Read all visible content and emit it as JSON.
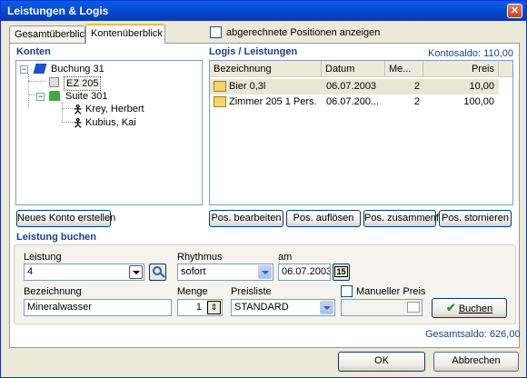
{
  "window": {
    "title": "Leistungen & Logis",
    "close_label": "✕"
  },
  "tabs": [
    {
      "label": "Gesamtüberblick"
    },
    {
      "label": "Kontenüberblick"
    }
  ],
  "show_settled": {
    "label": "abgerechnete Positionen anzeigen",
    "checked": false
  },
  "konten": {
    "title": "Konten",
    "tree": [
      {
        "label": "Buchung 31",
        "icon": "booking-icon"
      },
      {
        "label": "EZ 205",
        "icon": "room-icon"
      },
      {
        "label": "Suite 301",
        "icon": "suite-icon"
      },
      {
        "label": "Krey, Herbert",
        "icon": "person-icon"
      },
      {
        "label": "Kubius, Kai",
        "icon": "person-icon"
      }
    ],
    "new_account_button": "Neues Konto erstellen"
  },
  "logis": {
    "title": "Logis / Leistungen",
    "saldo": "Kontosaldo: 110,00",
    "columns": [
      "Bezeichnung",
      "Datum",
      "Me...",
      "Preis"
    ],
    "rows": [
      {
        "bezeichnung": "Bier 0,3l",
        "datum": "06.07.2003",
        "menge": "2",
        "preis": "10,00"
      },
      {
        "bezeichnung": "Zimmer 205  1 Pers.",
        "datum": "06.07.200...",
        "menge": "2",
        "preis": "100,00"
      }
    ],
    "buttons": [
      "Pos. bearbeiten",
      "Pos. auflösen",
      "Pos. zusammenf.",
      "Pos. stornieren"
    ]
  },
  "booking": {
    "title": "Leistung buchen",
    "leistung_label": "Leistung",
    "leistung_value": "4",
    "rhythmus_label": "Rhythmus",
    "rhythmus_value": "sofort",
    "am_label": "am",
    "am_value": "06.07.2003",
    "calendar_label": "15",
    "bezeichnung_label": "Bezeichnung",
    "bezeichnung_value": "Mineralwasser",
    "menge_label": "Menge",
    "menge_value": "1",
    "preisliste_label": "Preisliste",
    "preisliste_value": "STANDARD",
    "manual_price_label": "Manueller Preis",
    "manual_price_checked": false,
    "manual_price_value": "",
    "buchen_button": "Buchen"
  },
  "gesamtsaldo": "Gesamtsaldo: 626,00",
  "footer": {
    "ok": "OK",
    "cancel": "Abbrechen"
  },
  "colors": {
    "title_blue": "#0a5de8",
    "label_blue": "#1a3f8e",
    "tab_accent": "#fbb93b"
  }
}
